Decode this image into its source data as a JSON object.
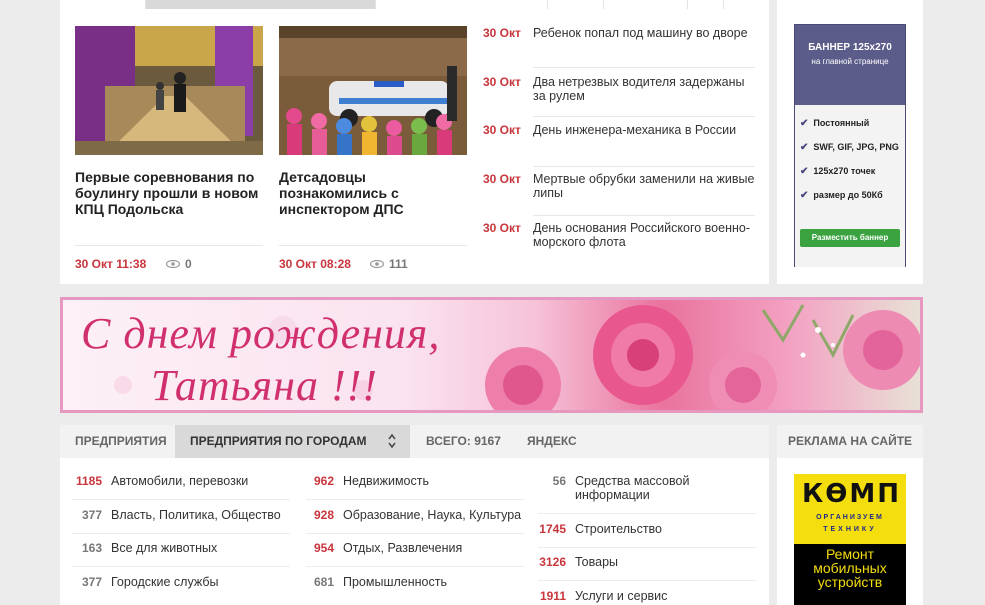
{
  "news": {
    "cards": [
      {
        "title": "Первые соревнования по боулингу прошли в новом КПЦ Подольска",
        "date": "30 Окт 11:38",
        "views": "0"
      },
      {
        "title": "Детсадовцы познакомились с инспектором ДПС",
        "date": "30 Окт 08:28",
        "views": "111"
      }
    ],
    "headlines": [
      {
        "date": "30 Окт",
        "text": "Ребенок попал под машину во дворе"
      },
      {
        "date": "30 Окт",
        "text": "Два нетрезвых водителя задержаны за рулем"
      },
      {
        "date": "30 Окт",
        "text": "День инженера-механика в России"
      },
      {
        "date": "30 Окт",
        "text": "Мертвые обрубки заменили на живые липы"
      },
      {
        "date": "30 Окт",
        "text": "День основания Российского военно-морского флота"
      }
    ]
  },
  "side_ad": {
    "title": "БАННЕР 125x270",
    "subtitle": "на главной странице",
    "features": [
      "Постоянный",
      "SWF, GIF, JPG, PNG",
      "125x270 точек",
      "размер до 50Кб"
    ],
    "button": "Разместить баннер"
  },
  "birthday_banner": {
    "line1": "С днем рождения,",
    "line2": "Татьяна !!!"
  },
  "enterprises": {
    "tabs": [
      "ПРЕДПРИЯТИЯ",
      "ПРЕДПРИЯТИЯ ПО ГОРОДАМ",
      "ВСЕГО: 9167",
      "ЯНДЕКС"
    ],
    "columns": [
      [
        {
          "count": "1185",
          "label": "Автомобили, перевозки",
          "highlight": true
        },
        {
          "count": "377",
          "label": "Власть, Политика, Общество",
          "highlight": false
        },
        {
          "count": "163",
          "label": "Все для животных",
          "highlight": false
        },
        {
          "count": "377",
          "label": "Городские службы",
          "highlight": false
        }
      ],
      [
        {
          "count": "962",
          "label": "Недвижимость",
          "highlight": true
        },
        {
          "count": "928",
          "label": "Образование, Наука, Культура",
          "highlight": true
        },
        {
          "count": "954",
          "label": "Отдых, Развлечения",
          "highlight": true
        },
        {
          "count": "681",
          "label": "Промышленность",
          "highlight": false
        }
      ],
      [
        {
          "count": "56",
          "label": "Средства массовой информации",
          "highlight": false
        },
        {
          "count": "1745",
          "label": "Строительство",
          "highlight": true
        },
        {
          "count": "3126",
          "label": "Товары",
          "highlight": true
        },
        {
          "count": "1911",
          "label": "Услуги и сервис",
          "highlight": true
        }
      ]
    ]
  },
  "bottom_ad": {
    "title": "РЕКЛАМА НА САЙТЕ",
    "logo": "КӨМП",
    "tagline1": "ОРГАНИЗУЕМ",
    "tagline2": "ТЕХНИКУ",
    "text": "Ремонт мобильных устройств"
  },
  "colors": {
    "accent": "#c8353c",
    "ad_purple": "#5c5c8a",
    "ad_green": "#3aa33f",
    "banner_pink": "#d0306e"
  }
}
